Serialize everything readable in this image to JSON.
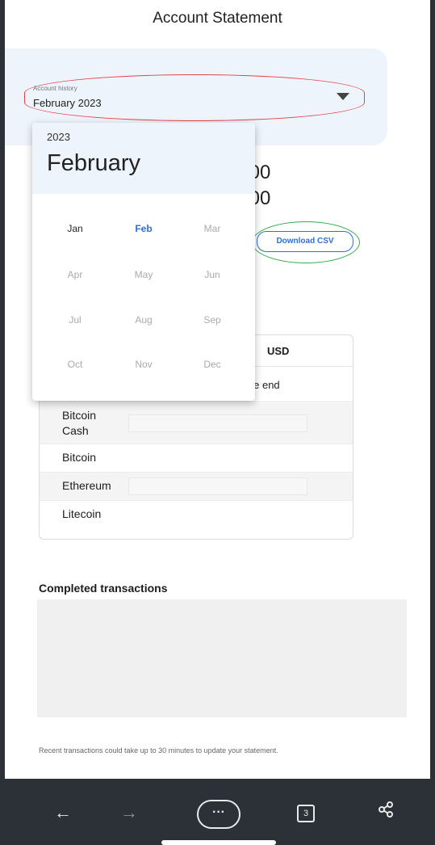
{
  "page": {
    "title": "Account Statement"
  },
  "history": {
    "label": "Account history",
    "value": "February 2023"
  },
  "balances": [
    ".00",
    ".00"
  ],
  "csv": {
    "label": "Download CSV"
  },
  "table": {
    "currency_header": "USD",
    "end_label": "ole end",
    "assets": [
      "Bitcoin Cash",
      "Bitcoin",
      "Ethereum",
      "Litecoin"
    ]
  },
  "transactions": {
    "title": "Completed transactions",
    "note": "Recent transactions could take up to 30 minutes to update your statement."
  },
  "picker": {
    "year": "2023",
    "selected_month": "February",
    "months": [
      "Jan",
      "Feb",
      "Mar",
      "Apr",
      "May",
      "Jun",
      "Jul",
      "Aug",
      "Sep",
      "Oct",
      "Nov",
      "Dec"
    ]
  },
  "browser": {
    "tab_count": "3",
    "more": "···"
  }
}
